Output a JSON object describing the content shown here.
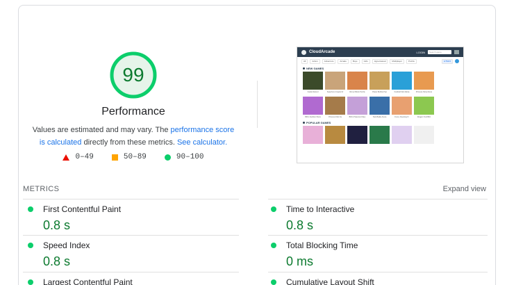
{
  "score": {
    "value": "99",
    "fraction": 0.99,
    "title": "Performance",
    "desc_prefix": "Values are estimated and may vary. The ",
    "desc_link1": "performance score is calculated",
    "desc_middle": " directly from these metrics. ",
    "desc_link2": "See calculator."
  },
  "legend": [
    {
      "label": "0–49",
      "shape": "triangle",
      "color": "#eb0f00"
    },
    {
      "label": "50–89",
      "shape": "square",
      "color": "#ffa400"
    },
    {
      "label": "90–100",
      "shape": "circle",
      "color": "#0cce6b"
    }
  ],
  "thumbnail": {
    "logo": "CloudArcade",
    "login": "LOGIN",
    "search_placeholder": "Search game",
    "nav": [
      "All",
      "Action",
      "Adventure",
      "Arcade",
      "Boys",
      "Girls",
      "Hypercasual",
      "Multiplayer",
      "Puzzle"
    ],
    "nav_button": "HTML5",
    "new_games_label": "NEW GAMES",
    "popular_games_label": "POPULAR GAMES",
    "new_games": [
      {
        "caption": "Castle Defend",
        "color": "#3b4a2a"
      },
      {
        "caption": "Superhero Couple Dr",
        "color": "#c9a47a"
      },
      {
        "caption": "Dinner Block Puzzle",
        "color": "#d9844a"
      },
      {
        "caption": "Planet Bubble Pop",
        "color": "#c8a05a"
      },
      {
        "caption": "Football Kick Mania",
        "color": "#2aa0d8"
      },
      {
        "caption": "Princess Party Dress",
        "color": "#e89a50"
      },
      {
        "caption": "BFFs Fashion Show",
        "color": "#b06ad0"
      },
      {
        "caption": "Princess Kids Fa",
        "color": "#a57b4a"
      },
      {
        "caption": "BFFs Pokemon Diary",
        "color": "#c4a0d8"
      },
      {
        "caption": "Tank Battle Arena",
        "color": "#3a6fa8"
      },
      {
        "caption": "Funny Cleaning Fr",
        "color": "#e8a070"
      },
      {
        "caption": "Dragon Fruit Blitz",
        "color": "#8cc850"
      }
    ],
    "popular_games": [
      {
        "color": "#e8b0d8"
      },
      {
        "color": "#b88a40"
      },
      {
        "color": "#202040"
      },
      {
        "color": "#2a7a4a"
      },
      {
        "color": "#e0d0f0"
      },
      {
        "color": "#f0f0f0"
      }
    ]
  },
  "metrics": {
    "section_label": "METRICS",
    "expand_label": "Expand view",
    "items": [
      {
        "name": "First Contentful Paint",
        "value": "0.8 s"
      },
      {
        "name": "Time to Interactive",
        "value": "0.8 s"
      },
      {
        "name": "Speed Index",
        "value": "0.8 s"
      },
      {
        "name": "Total Blocking Time",
        "value": "0 ms"
      },
      {
        "name": "Largest Contentful Paint",
        "value": ""
      },
      {
        "name": "Cumulative Layout Shift",
        "value": ""
      }
    ]
  }
}
